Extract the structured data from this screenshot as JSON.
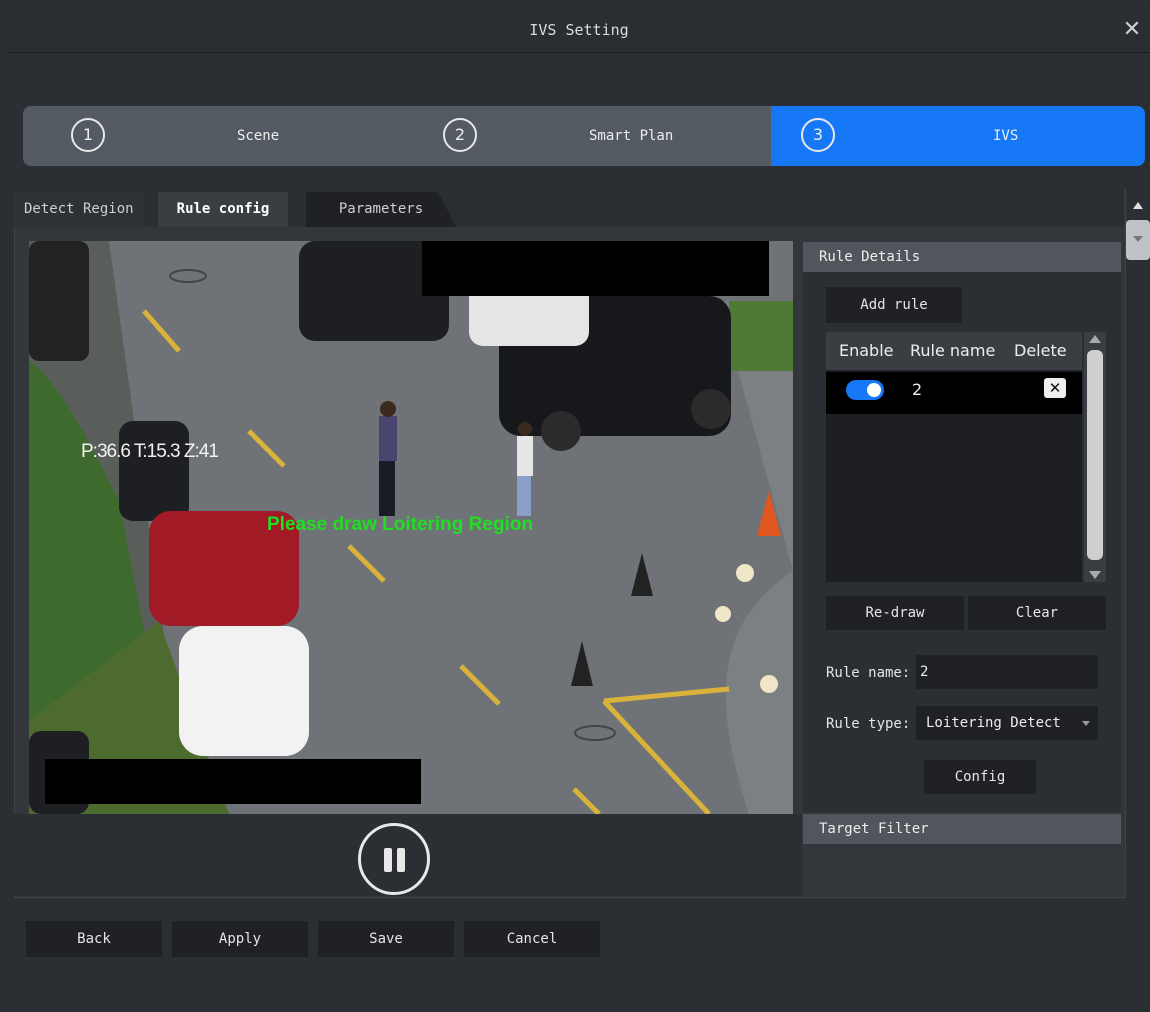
{
  "window": {
    "title": "IVS Setting",
    "close_glyph": "✕"
  },
  "stepper": {
    "active_color": "#1677f7",
    "steps": [
      {
        "num": "1",
        "label": "Scene"
      },
      {
        "num": "2",
        "label": "Smart Plan"
      },
      {
        "num": "3",
        "label": "IVS"
      }
    ]
  },
  "tabs": {
    "detect": "Detect Region",
    "rule": "Rule config",
    "params": "Parameters"
  },
  "video": {
    "ptz": "P:36.6 T:15.3 Z:41",
    "prompt": "Please draw Loitering Region",
    "prompt_color": "#22dd22"
  },
  "rule_details": {
    "header": "Rule Details",
    "add_rule": "Add rule",
    "columns": [
      "Enable",
      "Rule name",
      "Delete"
    ],
    "rows": [
      {
        "enabled": true,
        "name": "2"
      }
    ],
    "delete_glyph": "✕",
    "redraw": "Re-draw",
    "clear": "Clear",
    "rule_name_label": "Rule name:",
    "rule_name_value": "2",
    "rule_type_label": "Rule type:",
    "rule_type_value": "Loitering Detect",
    "config": "Config"
  },
  "target_filter": {
    "header": "Target Filter"
  },
  "footer": {
    "back": "Back",
    "apply": "Apply",
    "save": "Save",
    "cancel": "Cancel"
  }
}
